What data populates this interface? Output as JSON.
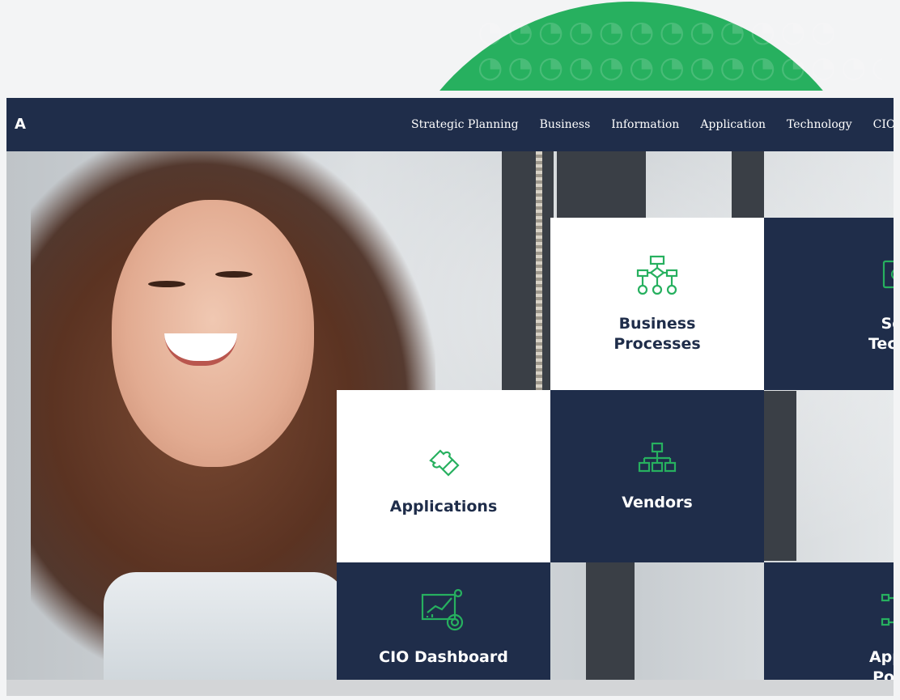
{
  "brand": {
    "text": "A"
  },
  "nav": {
    "items": [
      "Strategic Planning",
      "Business",
      "Information",
      "Application",
      "Technology",
      "CIO"
    ]
  },
  "tiles": {
    "business_processes": {
      "label": "Business Processes",
      "icon": "process-flowchart-icon"
    },
    "software_technology": {
      "label": "Softwa Technolo",
      "icon": "monitor-gears-icon"
    },
    "applications": {
      "label": "Applications",
      "icon": "puzzle-piece-icon"
    },
    "vendors": {
      "label": "Vendors",
      "icon": "org-chart-icon"
    },
    "cio_dashboard": {
      "label": "CIO Dashboard",
      "icon": "dashboard-chart-icon"
    },
    "application_portfolio": {
      "label": "Applicat Portfoli",
      "icon": "gear-network-icon"
    }
  },
  "colors": {
    "navy": "#1f2d4a",
    "green": "#27b05f",
    "white": "#ffffff"
  }
}
